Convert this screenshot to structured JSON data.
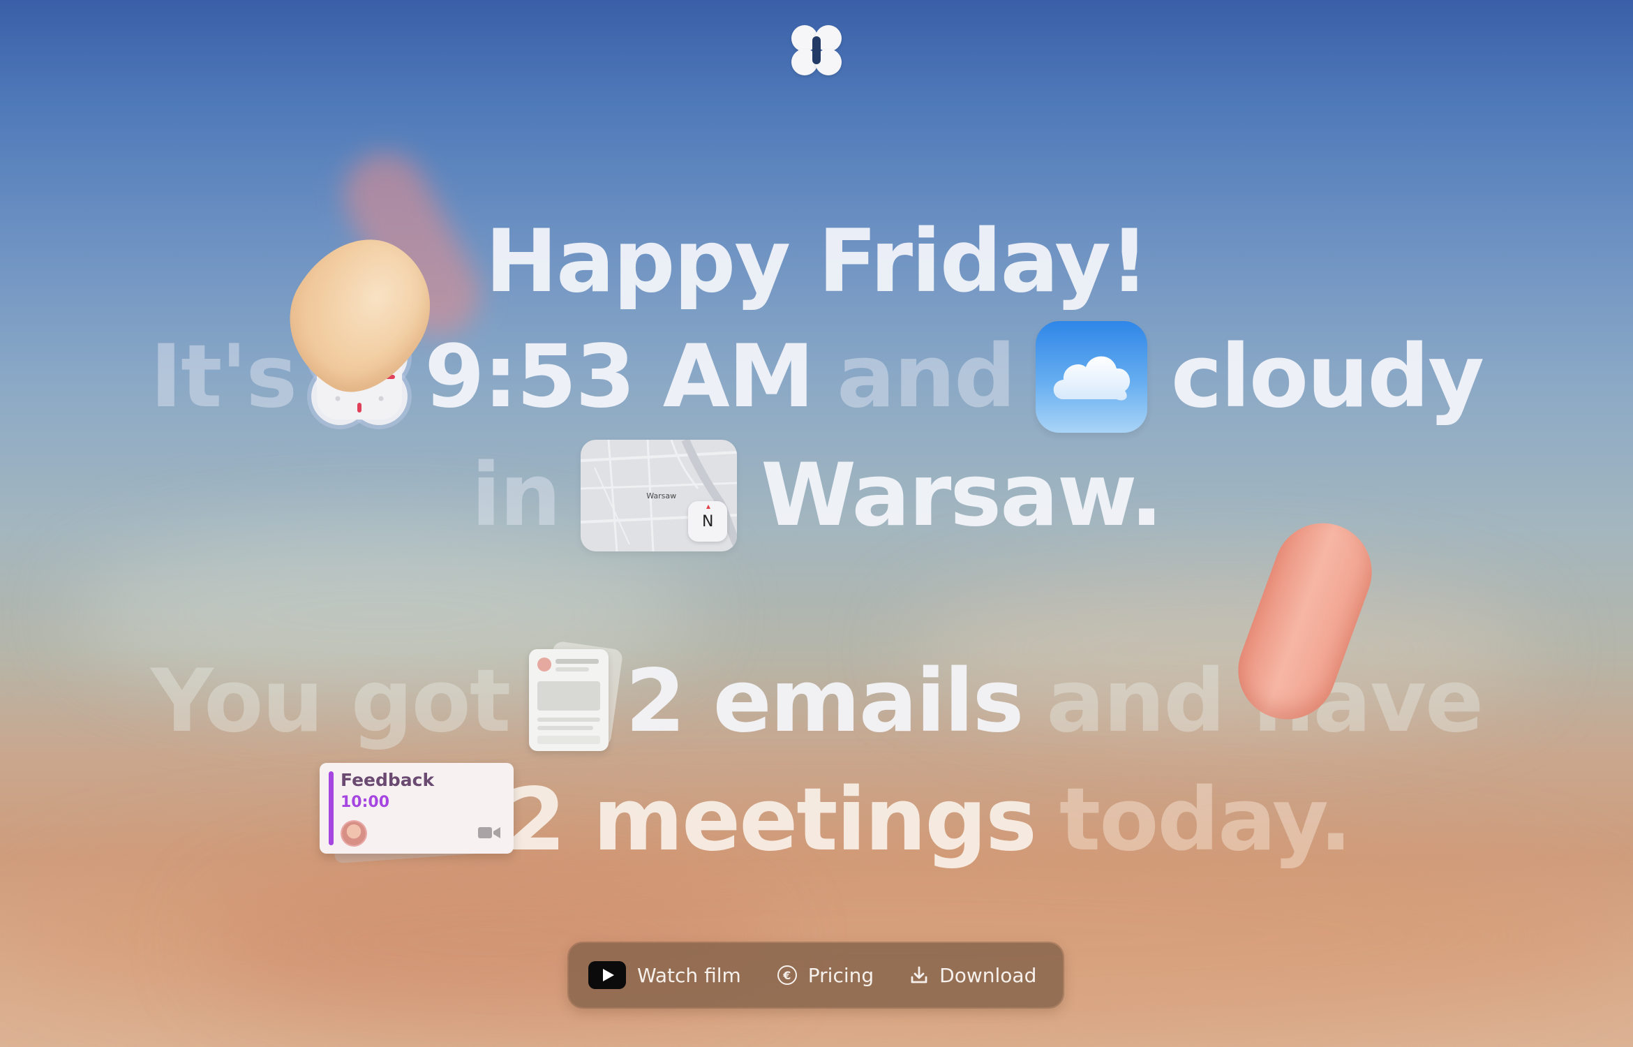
{
  "colors": {
    "sky_top": "#3a5fa8",
    "sky_bottom": "#dcb394",
    "dock_bg": "#82604a",
    "meeting_accent": "#a646e0",
    "clock_marker": "#e0405a",
    "weather_blue": "#2f86e8"
  },
  "logo": {
    "icon": "clover-logo-icon"
  },
  "headline": {
    "greeting": "Happy Friday!",
    "line2": {
      "prefix": "It's",
      "clock_icon": "clock-widget-icon",
      "time": "9:53 AM",
      "connector": "and",
      "weather_icon": "cloud-weather-icon",
      "weather": "cloudy"
    },
    "line3": {
      "prefix": "in",
      "map_icon": "map-widget-icon",
      "map_city_label": "Warsaw",
      "compass_label": "N",
      "city": "Warsaw."
    },
    "line4": {
      "prefix": "You got",
      "mail_icon": "email-stack-icon",
      "emails": "2 emails",
      "connector": "and have"
    },
    "line5": {
      "meetings": "2 meetings",
      "suffix": "today."
    }
  },
  "meeting_card": {
    "title": "Feedback",
    "time": "10:00",
    "avatar_icon": "avatar-icon",
    "video_icon": "video-camera-icon"
  },
  "dock": {
    "watch": {
      "label": "Watch film",
      "icon": "film-play-icon"
    },
    "pricing": {
      "label": "Pricing",
      "icon": "euro-circle-icon"
    },
    "download": {
      "label": "Download",
      "icon": "download-icon"
    }
  }
}
